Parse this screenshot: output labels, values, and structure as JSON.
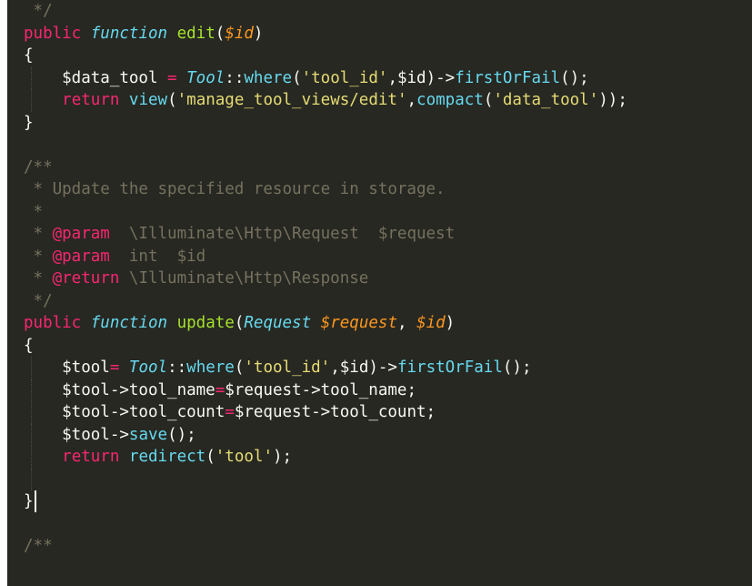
{
  "editor": {
    "theme": "monokai",
    "colors": {
      "background": "#272822",
      "text": "#f8f8f2",
      "keyword": "#f92672",
      "storage": "#66d9ef",
      "function_name": "#a6e22e",
      "parameter": "#fd971f",
      "string": "#e6db74",
      "comment": "#75715e"
    },
    "lines": [
      [
        [
          "cm",
          " */"
        ]
      ],
      [
        [
          "kw",
          "public"
        ],
        [
          "txt",
          " "
        ],
        [
          "sto",
          "function"
        ],
        [
          "txt",
          " "
        ],
        [
          "fn",
          "edit"
        ],
        [
          "txt",
          "("
        ],
        [
          "var",
          "$id"
        ],
        [
          "txt",
          ")"
        ]
      ],
      [
        [
          "txt",
          "{"
        ]
      ],
      [
        [
          "txt",
          "    $data_tool "
        ],
        [
          "op",
          "="
        ],
        [
          "txt",
          " "
        ],
        [
          "cls",
          "Tool"
        ],
        [
          "txt",
          "::"
        ],
        [
          "call",
          "where"
        ],
        [
          "txt",
          "("
        ],
        [
          "str",
          "'tool_id'"
        ],
        [
          "txt",
          ",$id)->"
        ],
        [
          "call",
          "firstOrFail"
        ],
        [
          "txt",
          "();"
        ]
      ],
      [
        [
          "txt",
          "    "
        ],
        [
          "kw",
          "return"
        ],
        [
          "txt",
          " "
        ],
        [
          "call",
          "view"
        ],
        [
          "txt",
          "("
        ],
        [
          "str",
          "'manage_tool_views/edit'"
        ],
        [
          "txt",
          ","
        ],
        [
          "call",
          "compact"
        ],
        [
          "txt",
          "("
        ],
        [
          "str",
          "'data_tool'"
        ],
        [
          "txt",
          "));"
        ]
      ],
      [
        [
          "txt",
          "}"
        ]
      ],
      [
        [
          "txt",
          ""
        ]
      ],
      [
        [
          "cm",
          "/**"
        ]
      ],
      [
        [
          "cm",
          " * Update the specified resource in storage."
        ]
      ],
      [
        [
          "cm",
          " *"
        ]
      ],
      [
        [
          "cm",
          " * "
        ],
        [
          "tag",
          "@param"
        ],
        [
          "cm",
          "  \\Illuminate\\Http\\Request  $request"
        ]
      ],
      [
        [
          "cm",
          " * "
        ],
        [
          "tag",
          "@param"
        ],
        [
          "cm",
          "  int  $id"
        ]
      ],
      [
        [
          "cm",
          " * "
        ],
        [
          "tag",
          "@return"
        ],
        [
          "cm",
          " \\Illuminate\\Http\\Response"
        ]
      ],
      [
        [
          "cm",
          " */"
        ]
      ],
      [
        [
          "kw",
          "public"
        ],
        [
          "txt",
          " "
        ],
        [
          "sto",
          "function"
        ],
        [
          "txt",
          " "
        ],
        [
          "fn",
          "update"
        ],
        [
          "txt",
          "("
        ],
        [
          "cls",
          "Request"
        ],
        [
          "txt",
          " "
        ],
        [
          "var",
          "$request"
        ],
        [
          "txt",
          ", "
        ],
        [
          "var",
          "$id"
        ],
        [
          "txt",
          ")"
        ]
      ],
      [
        [
          "txt",
          "{"
        ]
      ],
      [
        [
          "txt",
          "    $tool"
        ],
        [
          "op",
          "="
        ],
        [
          "txt",
          " "
        ],
        [
          "cls",
          "Tool"
        ],
        [
          "txt",
          "::"
        ],
        [
          "call",
          "where"
        ],
        [
          "txt",
          "("
        ],
        [
          "str",
          "'tool_id'"
        ],
        [
          "txt",
          ",$id)->"
        ],
        [
          "call",
          "firstOrFail"
        ],
        [
          "txt",
          "();"
        ]
      ],
      [
        [
          "txt",
          "    $tool->tool_name"
        ],
        [
          "op",
          "="
        ],
        [
          "txt",
          "$request->tool_name;"
        ]
      ],
      [
        [
          "txt",
          "    $tool->tool_count"
        ],
        [
          "op",
          "="
        ],
        [
          "txt",
          "$request->tool_count;"
        ]
      ],
      [
        [
          "txt",
          "    $tool->"
        ],
        [
          "call",
          "save"
        ],
        [
          "txt",
          "();"
        ]
      ],
      [
        [
          "txt",
          "    "
        ],
        [
          "kw",
          "return"
        ],
        [
          "txt",
          " "
        ],
        [
          "call",
          "redirect"
        ],
        [
          "txt",
          "("
        ],
        [
          "str",
          "'tool'"
        ],
        [
          "txt",
          ");"
        ]
      ],
      [
        [
          "txt",
          ""
        ]
      ],
      [
        [
          "txt",
          "}"
        ],
        [
          "cursor",
          ""
        ]
      ],
      [
        [
          "txt",
          ""
        ]
      ],
      [
        [
          "cm",
          "/**"
        ]
      ]
    ]
  }
}
